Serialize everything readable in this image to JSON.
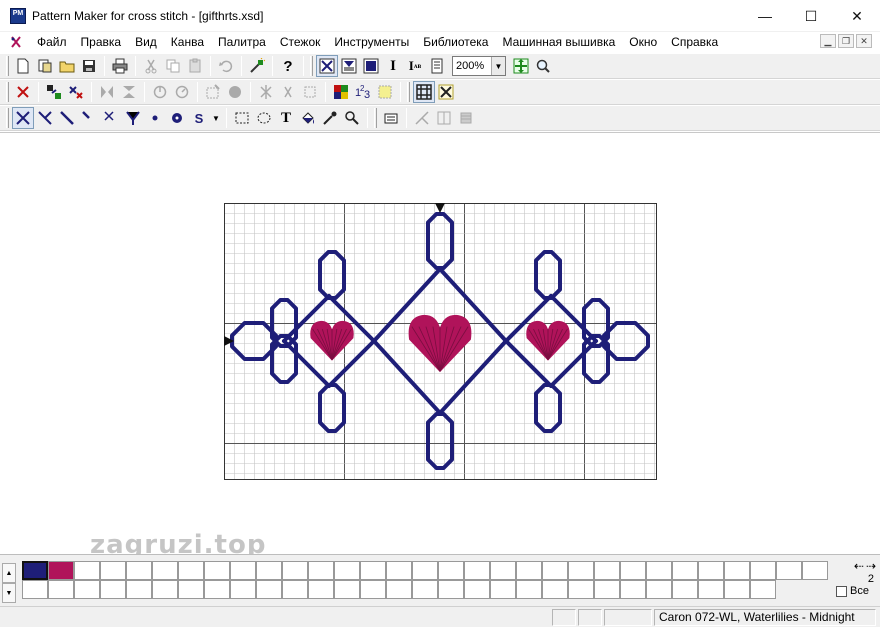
{
  "window": {
    "title": "Pattern Maker for cross stitch - [gifthrts.xsd]",
    "app_icon_text": "PM",
    "minimize": "—",
    "maximize": "☐",
    "close": "✕"
  },
  "menu": {
    "items": [
      "Файл",
      "Правка",
      "Вид",
      "Канва",
      "Палитра",
      "Стежок",
      "Инструменты",
      "Библиотека",
      "Машинная вышивка",
      "Окно",
      "Справка"
    ]
  },
  "toolbar": {
    "zoom_value": "200%"
  },
  "watermark": "zagruzi.top",
  "colors": {
    "thread_navy": "#1e1e78",
    "thread_magenta": "#b0135a",
    "grid_line": "#c4c4c4",
    "grid_major": "#555555"
  },
  "palette": {
    "page": "2",
    "all_label": "Все",
    "swatches": [
      "#1e1e78",
      "#b0135a"
    ]
  },
  "status": {
    "thread": "Caron  072-WL, Waterlilies - Midnight"
  }
}
